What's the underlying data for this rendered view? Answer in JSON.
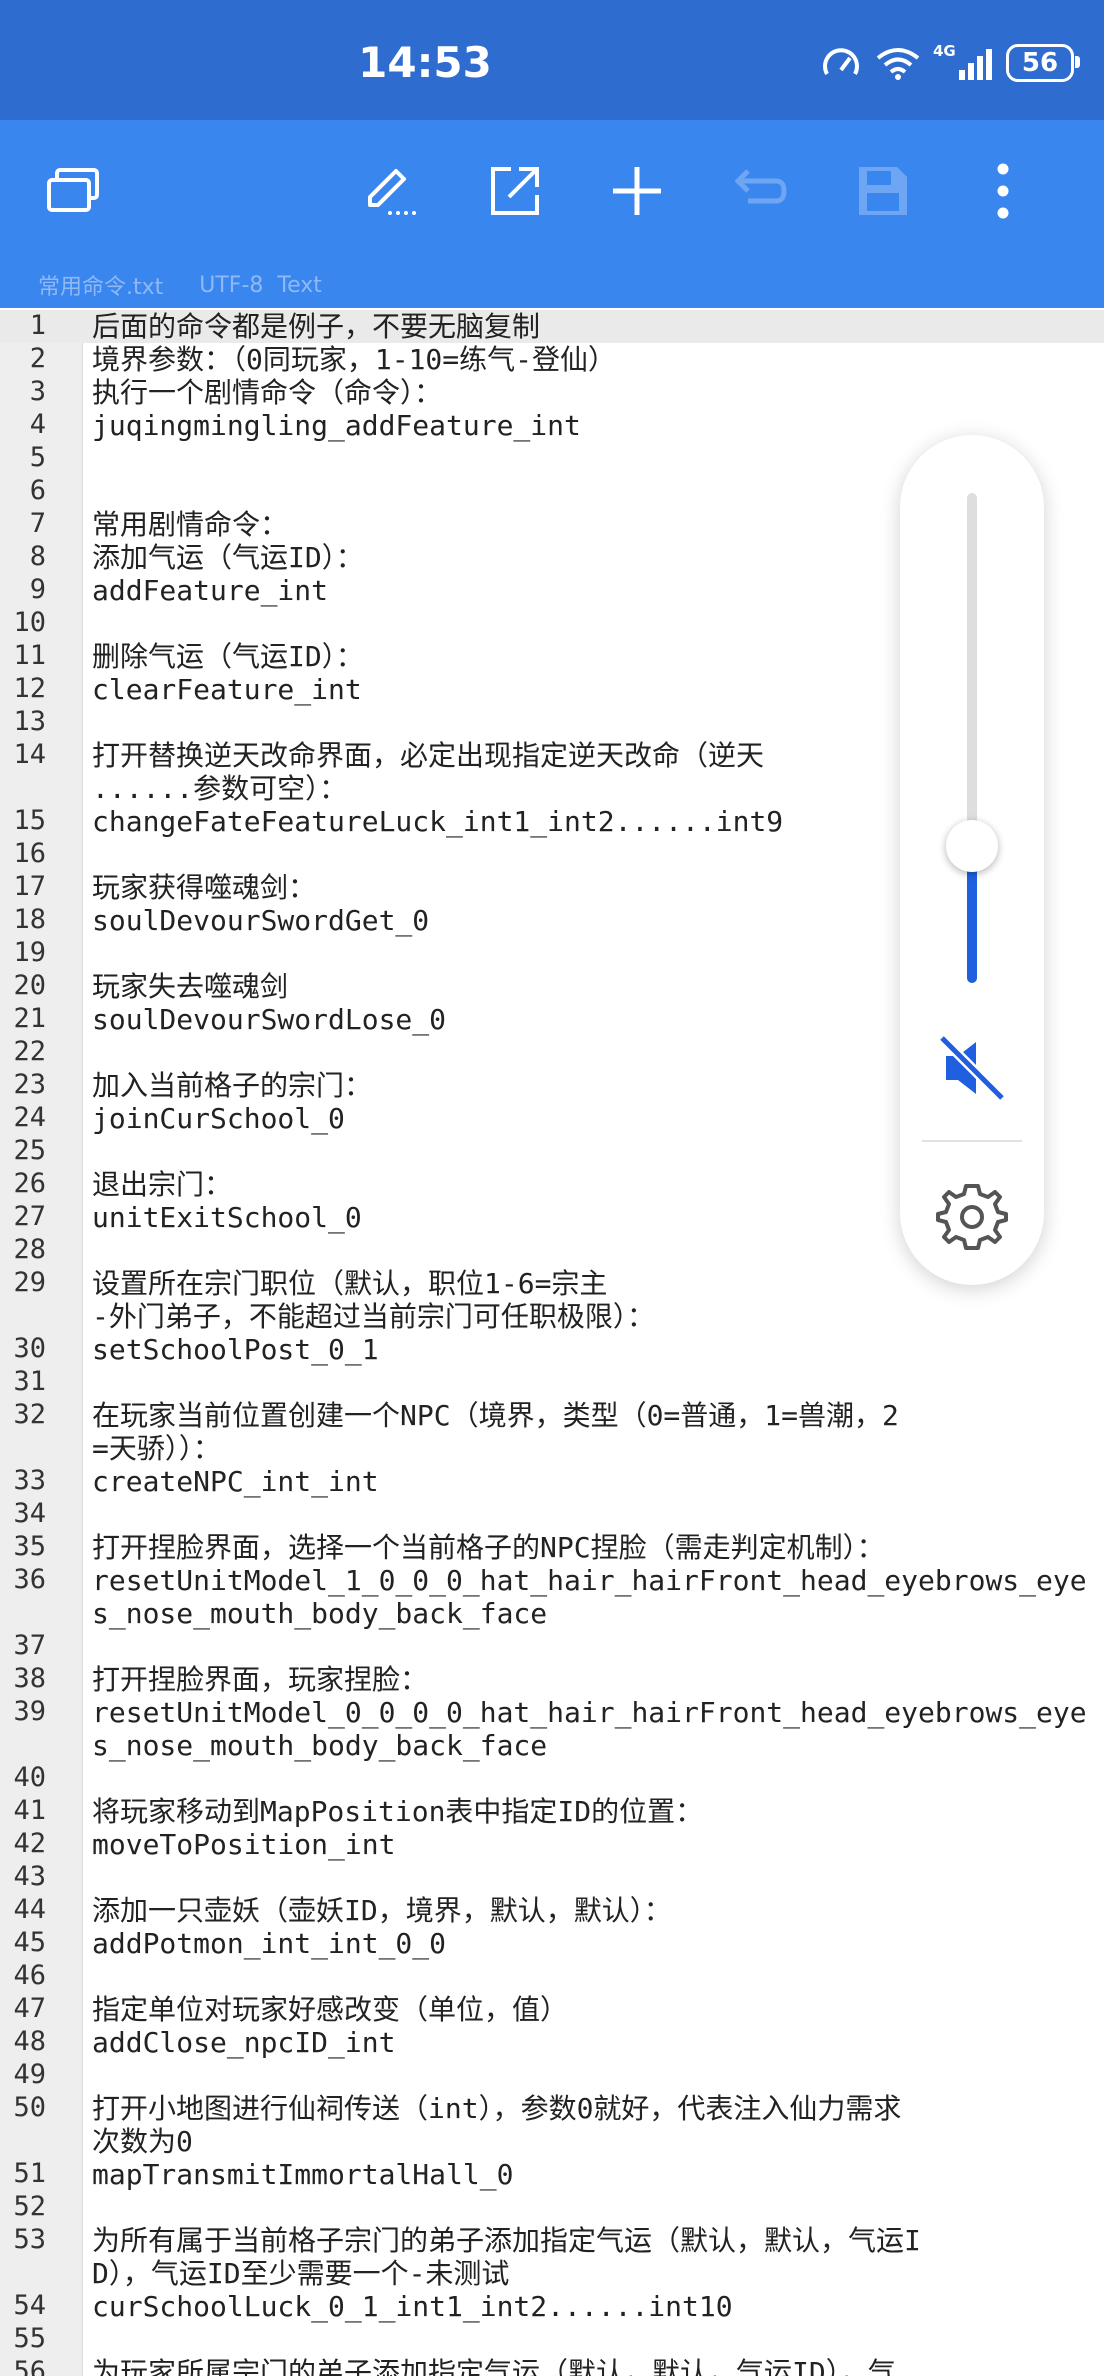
{
  "status_bar": {
    "time": "14:53",
    "network_label": "4G",
    "battery": "56"
  },
  "toolbar": {
    "icons": [
      "tabs-icon",
      "edit-icon",
      "open-external-icon",
      "add-icon",
      "undo-icon",
      "save-icon",
      "more-icon"
    ]
  },
  "file": {
    "name": "常用命令.txt",
    "encoding": "UTF-8",
    "type": "Text"
  },
  "lines": [
    {
      "n": "1",
      "text": "后面的命令都是例子，不要无脑复制"
    },
    {
      "n": "2",
      "text": "境界参数：（0同玩家，1-10=练气-登仙）"
    },
    {
      "n": "3",
      "text": "执行一个剧情命令（命令）："
    },
    {
      "n": "4",
      "text": "juqingmingling_addFeature_int"
    },
    {
      "n": "5",
      "text": ""
    },
    {
      "n": "6",
      "text": ""
    },
    {
      "n": "7",
      "text": "常用剧情命令："
    },
    {
      "n": "8",
      "text": "添加气运（气运ID）："
    },
    {
      "n": "9",
      "text": "addFeature_int"
    },
    {
      "n": "10",
      "text": ""
    },
    {
      "n": "11",
      "text": "删除气运（气运ID）："
    },
    {
      "n": "12",
      "text": "clearFeature_int"
    },
    {
      "n": "13",
      "text": ""
    },
    {
      "n": "14",
      "text": "打开替换逆天改命界面，必定出现指定逆天改命（逆天\n......参数可空）："
    },
    {
      "n": "15",
      "text": "changeFateFeatureLuck_int1_int2......int9"
    },
    {
      "n": "16",
      "text": ""
    },
    {
      "n": "17",
      "text": "玩家获得噬魂剑："
    },
    {
      "n": "18",
      "text": "soulDevourSwordGet_0"
    },
    {
      "n": "19",
      "text": ""
    },
    {
      "n": "20",
      "text": "玩家失去噬魂剑"
    },
    {
      "n": "21",
      "text": "soulDevourSwordLose_0"
    },
    {
      "n": "22",
      "text": ""
    },
    {
      "n": "23",
      "text": "加入当前格子的宗门："
    },
    {
      "n": "24",
      "text": "joinCurSchool_0"
    },
    {
      "n": "25",
      "text": ""
    },
    {
      "n": "26",
      "text": "退出宗门："
    },
    {
      "n": "27",
      "text": "unitExitSchool_0"
    },
    {
      "n": "28",
      "text": ""
    },
    {
      "n": "29",
      "text": "设置所在宗门职位（默认，职位1-6=宗主\n-外门弟子，不能超过当前宗门可任职极限）："
    },
    {
      "n": "30",
      "text": "setSchoolPost_0_1"
    },
    {
      "n": "31",
      "text": ""
    },
    {
      "n": "32",
      "text": "在玩家当前位置创建一个NPC（境界，类型（0=普通，1=兽潮，2\n=天骄））："
    },
    {
      "n": "33",
      "text": "createNPC_int_int"
    },
    {
      "n": "34",
      "text": ""
    },
    {
      "n": "35",
      "text": "打开捏脸界面，选择一个当前格子的NPC捏脸（需走判定机制）："
    },
    {
      "n": "36",
      "text": "resetUnitModel_1_0_0_0_hat_hair_hairFront_head_eyebrows_eye\ns_nose_mouth_body_back_face"
    },
    {
      "n": "37",
      "text": ""
    },
    {
      "n": "38",
      "text": "打开捏脸界面，玩家捏脸："
    },
    {
      "n": "39",
      "text": "resetUnitModel_0_0_0_0_hat_hair_hairFront_head_eyebrows_eye\ns_nose_mouth_body_back_face"
    },
    {
      "n": "40",
      "text": ""
    },
    {
      "n": "41",
      "text": "将玩家移动到MapPosition表中指定ID的位置："
    },
    {
      "n": "42",
      "text": "moveToPosition_int"
    },
    {
      "n": "43",
      "text": ""
    },
    {
      "n": "44",
      "text": "添加一只壶妖（壶妖ID，境界，默认，默认）："
    },
    {
      "n": "45",
      "text": "addPotmon_int_int_0_0"
    },
    {
      "n": "46",
      "text": ""
    },
    {
      "n": "47",
      "text": "指定单位对玩家好感改变（单位，值）"
    },
    {
      "n": "48",
      "text": "addClose_npcID_int"
    },
    {
      "n": "49",
      "text": ""
    },
    {
      "n": "50",
      "text": "打开小地图进行仙祠传送（int），参数0就好，代表注入仙力需求\n次数为0"
    },
    {
      "n": "51",
      "text": "mapTransmitImmortalHall_0"
    },
    {
      "n": "52",
      "text": ""
    },
    {
      "n": "53",
      "text": "为所有属于当前格子宗门的弟子添加指定气运（默认，默认，气运I\nD），气运ID至少需要一个-未测试"
    },
    {
      "n": "54",
      "text": "curSchoolLuck_0_1_int1_int2......int10"
    },
    {
      "n": "55",
      "text": ""
    },
    {
      "n": "56",
      "text": "为玩家所属宗门的弟子添加指定气运（默认，默认，气运ID），气"
    }
  ],
  "volume_panel": {
    "level": 0.28,
    "muted": true
  }
}
